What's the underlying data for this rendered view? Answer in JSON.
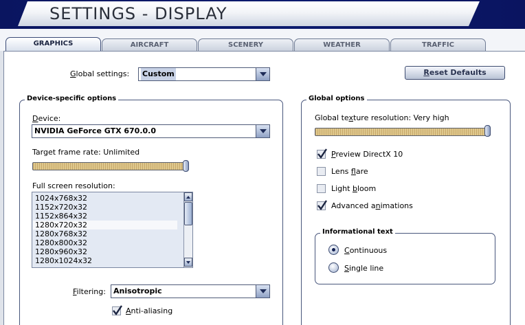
{
  "header": {
    "title": "SETTINGS - DISPLAY"
  },
  "tabs": [
    {
      "label": "GRAPHICS",
      "active": true
    },
    {
      "label": "AIRCRAFT",
      "active": false
    },
    {
      "label": "SCENERY",
      "active": false
    },
    {
      "label": "WEATHER",
      "active": false
    },
    {
      "label": "TRAFFIC",
      "active": false
    }
  ],
  "global_settings": {
    "label_hotkey": "G",
    "label_rest": "lobal settings:",
    "value": "Custom"
  },
  "reset_button": {
    "hotkey": "R",
    "rest": "eset Defaults"
  },
  "device_group": {
    "title": "Device-specific options",
    "device_label_hotkey": "D",
    "device_label_rest": "evice:",
    "device_value": "NVIDIA GeForce GTX 670.0.0",
    "frame_rate_label": "Target frame rate: Unlimited",
    "frame_rate_fraction": 1.0,
    "resolution_label": "Full screen resolution:",
    "resolutions": [
      "1024x768x32",
      "1152x720x32",
      "1152x864x32",
      "1280x720x32",
      "1280x768x32",
      "1280x800x32",
      "1280x960x32",
      "1280x1024x32"
    ],
    "selected_resolution_index": 3,
    "filtering_label_hotkey": "F",
    "filtering_label_rest": "iltering:",
    "filtering_value": "Anisotropic",
    "anti_aliasing_hotkey": "A",
    "anti_aliasing_rest": "nti-aliasing",
    "anti_aliasing_checked": true
  },
  "global_group": {
    "title": "Global options",
    "texture_label_a": "Global te",
    "texture_label_hotkey": "x",
    "texture_label_b": "ture resolution: Very high",
    "texture_fraction": 1.0,
    "options": [
      {
        "hotkey": "P",
        "rest": "review DirectX 10",
        "checked": true
      },
      {
        "pre": "Lens ",
        "hotkey": "f",
        "rest": "lare",
        "checked": false
      },
      {
        "pre": "Light ",
        "hotkey": "b",
        "rest": "loom",
        "checked": false
      },
      {
        "pre": "Advanced a",
        "hotkey": "n",
        "rest": "imations",
        "checked": true
      }
    ]
  },
  "info_group": {
    "title": "Informational text",
    "continuous_hotkey": "C",
    "continuous_rest": "ontinuous",
    "single_hotkey": "S",
    "single_rest": "ingle line",
    "selected": "Continuous"
  }
}
